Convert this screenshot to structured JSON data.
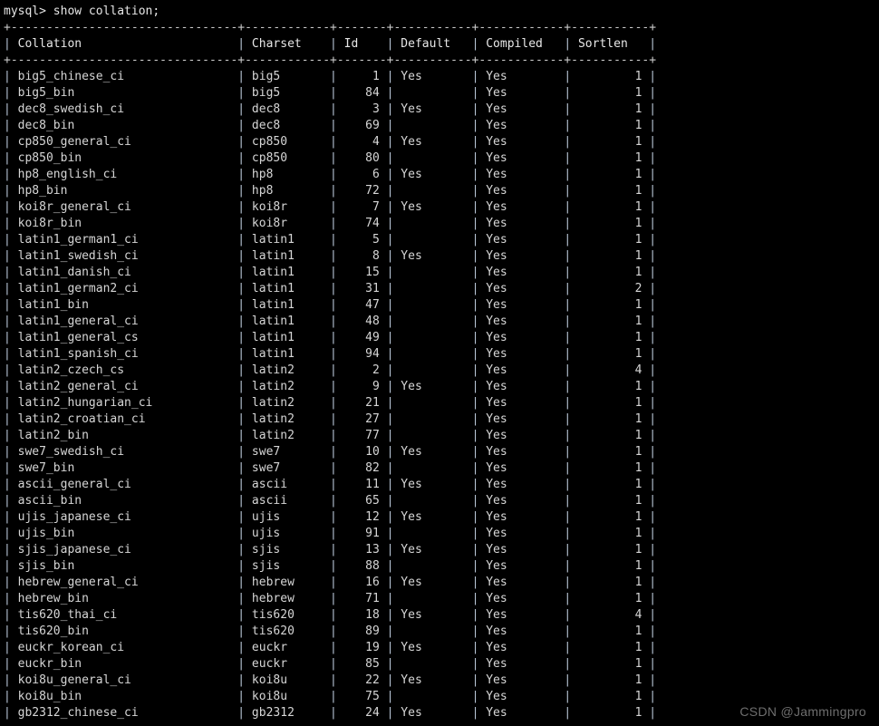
{
  "terminal": {
    "prompt": "mysql> ",
    "command": "show collation;",
    "prompt_line": "mysql> show collation;",
    "watermark": "CSDN @Jammingpro",
    "background_color": "#000000",
    "text_color": "#d6d6d6",
    "border_color": "#b9c6d6"
  },
  "table": {
    "columns": [
      {
        "label": "Collation",
        "width": 30,
        "align": "left"
      },
      {
        "label": "Charset",
        "width": 10,
        "align": "left"
      },
      {
        "label": "Id",
        "width": 5,
        "align": "right"
      },
      {
        "label": "Default",
        "width": 9,
        "align": "left"
      },
      {
        "label": "Compiled",
        "width": 10,
        "align": "left"
      },
      {
        "label": "Sortlen",
        "width": 9,
        "align": "right"
      }
    ],
    "rows": [
      [
        "big5_chinese_ci",
        "big5",
        "1",
        "Yes",
        "Yes",
        "1"
      ],
      [
        "big5_bin",
        "big5",
        "84",
        "",
        "Yes",
        "1"
      ],
      [
        "dec8_swedish_ci",
        "dec8",
        "3",
        "Yes",
        "Yes",
        "1"
      ],
      [
        "dec8_bin",
        "dec8",
        "69",
        "",
        "Yes",
        "1"
      ],
      [
        "cp850_general_ci",
        "cp850",
        "4",
        "Yes",
        "Yes",
        "1"
      ],
      [
        "cp850_bin",
        "cp850",
        "80",
        "",
        "Yes",
        "1"
      ],
      [
        "hp8_english_ci",
        "hp8",
        "6",
        "Yes",
        "Yes",
        "1"
      ],
      [
        "hp8_bin",
        "hp8",
        "72",
        "",
        "Yes",
        "1"
      ],
      [
        "koi8r_general_ci",
        "koi8r",
        "7",
        "Yes",
        "Yes",
        "1"
      ],
      [
        "koi8r_bin",
        "koi8r",
        "74",
        "",
        "Yes",
        "1"
      ],
      [
        "latin1_german1_ci",
        "latin1",
        "5",
        "",
        "Yes",
        "1"
      ],
      [
        "latin1_swedish_ci",
        "latin1",
        "8",
        "Yes",
        "Yes",
        "1"
      ],
      [
        "latin1_danish_ci",
        "latin1",
        "15",
        "",
        "Yes",
        "1"
      ],
      [
        "latin1_german2_ci",
        "latin1",
        "31",
        "",
        "Yes",
        "2"
      ],
      [
        "latin1_bin",
        "latin1",
        "47",
        "",
        "Yes",
        "1"
      ],
      [
        "latin1_general_ci",
        "latin1",
        "48",
        "",
        "Yes",
        "1"
      ],
      [
        "latin1_general_cs",
        "latin1",
        "49",
        "",
        "Yes",
        "1"
      ],
      [
        "latin1_spanish_ci",
        "latin1",
        "94",
        "",
        "Yes",
        "1"
      ],
      [
        "latin2_czech_cs",
        "latin2",
        "2",
        "",
        "Yes",
        "4"
      ],
      [
        "latin2_general_ci",
        "latin2",
        "9",
        "Yes",
        "Yes",
        "1"
      ],
      [
        "latin2_hungarian_ci",
        "latin2",
        "21",
        "",
        "Yes",
        "1"
      ],
      [
        "latin2_croatian_ci",
        "latin2",
        "27",
        "",
        "Yes",
        "1"
      ],
      [
        "latin2_bin",
        "latin2",
        "77",
        "",
        "Yes",
        "1"
      ],
      [
        "swe7_swedish_ci",
        "swe7",
        "10",
        "Yes",
        "Yes",
        "1"
      ],
      [
        "swe7_bin",
        "swe7",
        "82",
        "",
        "Yes",
        "1"
      ],
      [
        "ascii_general_ci",
        "ascii",
        "11",
        "Yes",
        "Yes",
        "1"
      ],
      [
        "ascii_bin",
        "ascii",
        "65",
        "",
        "Yes",
        "1"
      ],
      [
        "ujis_japanese_ci",
        "ujis",
        "12",
        "Yes",
        "Yes",
        "1"
      ],
      [
        "ujis_bin",
        "ujis",
        "91",
        "",
        "Yes",
        "1"
      ],
      [
        "sjis_japanese_ci",
        "sjis",
        "13",
        "Yes",
        "Yes",
        "1"
      ],
      [
        "sjis_bin",
        "sjis",
        "88",
        "",
        "Yes",
        "1"
      ],
      [
        "hebrew_general_ci",
        "hebrew",
        "16",
        "Yes",
        "Yes",
        "1"
      ],
      [
        "hebrew_bin",
        "hebrew",
        "71",
        "",
        "Yes",
        "1"
      ],
      [
        "tis620_thai_ci",
        "tis620",
        "18",
        "Yes",
        "Yes",
        "4"
      ],
      [
        "tis620_bin",
        "tis620",
        "89",
        "",
        "Yes",
        "1"
      ],
      [
        "euckr_korean_ci",
        "euckr",
        "19",
        "Yes",
        "Yes",
        "1"
      ],
      [
        "euckr_bin",
        "euckr",
        "85",
        "",
        "Yes",
        "1"
      ],
      [
        "koi8u_general_ci",
        "koi8u",
        "22",
        "Yes",
        "Yes",
        "1"
      ],
      [
        "koi8u_bin",
        "koi8u",
        "75",
        "",
        "Yes",
        "1"
      ],
      [
        "gb2312_chinese_ci",
        "gb2312",
        "24",
        "Yes",
        "Yes",
        "1"
      ]
    ]
  }
}
